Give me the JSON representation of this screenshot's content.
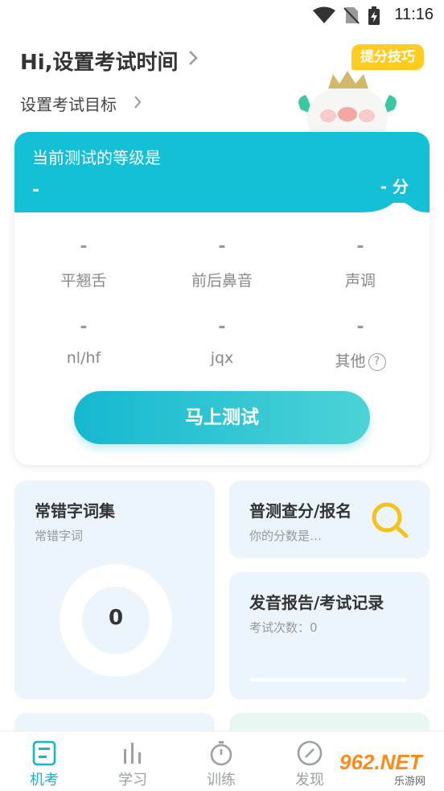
{
  "status_bar": {
    "time": "11:16"
  },
  "header": {
    "greeting": "Hi,设置考试时间",
    "goal": "设置考试目标",
    "tips_badge": "提分技巧"
  },
  "level_card": {
    "title": "当前测试的等级是",
    "level_value": "-",
    "score_value": "-",
    "score_unit": "分",
    "items": [
      {
        "value": "-",
        "label": "平翘舌"
      },
      {
        "value": "-",
        "label": "前后鼻音"
      },
      {
        "value": "-",
        "label": "声调"
      },
      {
        "value": "-",
        "label": "nl/hf"
      },
      {
        "value": "-",
        "label": "jqx"
      },
      {
        "value": "-",
        "label": "其他"
      }
    ],
    "help_symbol": "?",
    "test_button": "马上测试"
  },
  "tiles": {
    "mistakes": {
      "title": "常错字词集",
      "subtitle": "常错字词",
      "count": "0"
    },
    "query": {
      "title": "普测查分/报名",
      "subtitle": "你的分数是…"
    },
    "report": {
      "title": "发音报告/考试记录",
      "subtitle": "考试次数：0"
    }
  },
  "tabbar": {
    "tabs": [
      {
        "label": "机考",
        "icon": "exam-icon",
        "active": true
      },
      {
        "label": "学习",
        "icon": "bars-icon",
        "active": false
      },
      {
        "label": "训练",
        "icon": "stopwatch-icon",
        "active": false
      },
      {
        "label": "发现",
        "icon": "compass-icon",
        "active": false
      }
    ]
  },
  "watermark": {
    "brand": "962.NET",
    "caption": "乐游网"
  },
  "colors": {
    "accent": "#13c0d5",
    "badge": "#ffcc1f",
    "tile_bg": "#ecf4fc",
    "search": "#f4c21a"
  }
}
